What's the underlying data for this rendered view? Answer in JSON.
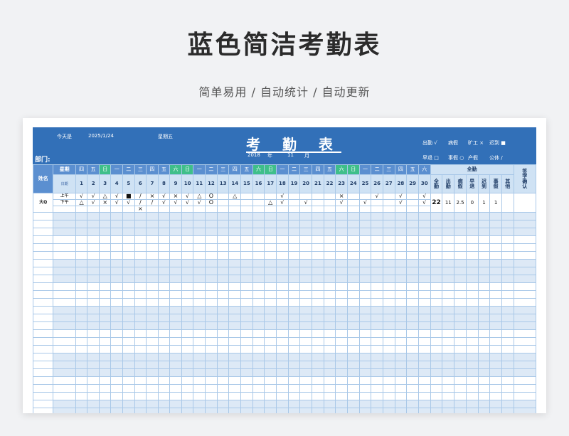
{
  "page": {
    "title": "蓝色简洁考勤表",
    "subtitle": "简单易用 / 自动统计 / 自动更新"
  },
  "banner": {
    "today_label": "今天是",
    "today_value": "2025/1/24",
    "weekday_value": "星期五",
    "title": "考 勤 表",
    "year": "2018",
    "year_label": "年",
    "month": "11",
    "month_label": "月",
    "dept_label": "部门:",
    "legend_row1": [
      "出勤 √",
      "病假 ",
      "旷工 ×",
      "迟到 ■"
    ],
    "legend_row2": [
      "早退 □",
      "事假 ○",
      "产假 ",
      "公休 /"
    ]
  },
  "table": {
    "name_header": "姓名",
    "weekday_header": "星期",
    "date_header": "日期",
    "weekdays": [
      "四",
      "五",
      "日",
      "一",
      "二",
      "三",
      "四",
      "五",
      "六",
      "日",
      "一",
      "二",
      "三",
      "四",
      "五",
      "六",
      "日",
      "一",
      "二",
      "三",
      "四",
      "五",
      "六",
      "日",
      "一",
      "二",
      "三",
      "四",
      "五",
      "六"
    ],
    "weekend_flags": [
      0,
      0,
      1,
      0,
      0,
      0,
      0,
      0,
      1,
      1,
      0,
      0,
      0,
      0,
      0,
      1,
      1,
      0,
      0,
      0,
      0,
      0,
      1,
      1,
      0,
      0,
      0,
      0,
      0,
      0
    ],
    "days": [
      "1",
      "2",
      "3",
      "4",
      "5",
      "6",
      "7",
      "8",
      "9",
      "10",
      "11",
      "12",
      "13",
      "14",
      "15",
      "16",
      "17",
      "18",
      "19",
      "20",
      "21",
      "22",
      "23",
      "24",
      "25",
      "26",
      "27",
      "28",
      "29",
      "30"
    ],
    "summary_header": "全勤",
    "summary_cols": [
      "全\n勤",
      "出\n勤",
      "病\n假",
      "早\n退",
      "迟\n到",
      "事\n假",
      "其\n他"
    ],
    "sign_header": "签\n字\n确\n认",
    "employee": {
      "name": "大Q",
      "am_label": "上午",
      "pm_label": "下午",
      "am": [
        "√",
        "√",
        "△",
        "√",
        "■",
        "/",
        "×",
        "√",
        "×",
        "√",
        "△",
        "O",
        "",
        "△",
        "",
        "",
        "",
        "√",
        "",
        "",
        "",
        "",
        "×",
        "",
        "",
        "√",
        "",
        "√",
        "",
        "√"
      ],
      "pm": [
        "△",
        "√",
        "×",
        "√",
        "√",
        "/",
        "/",
        "√",
        "√",
        "√",
        "√",
        "O",
        "",
        "",
        "",
        "",
        "△",
        "√",
        "",
        "√",
        "",
        "",
        "√",
        "",
        "√",
        "",
        "",
        "√",
        "",
        "√"
      ],
      "extra_mark": "×",
      "summary": [
        "22",
        "11",
        "2.5",
        "0",
        "1",
        "1",
        ""
      ]
    }
  }
}
